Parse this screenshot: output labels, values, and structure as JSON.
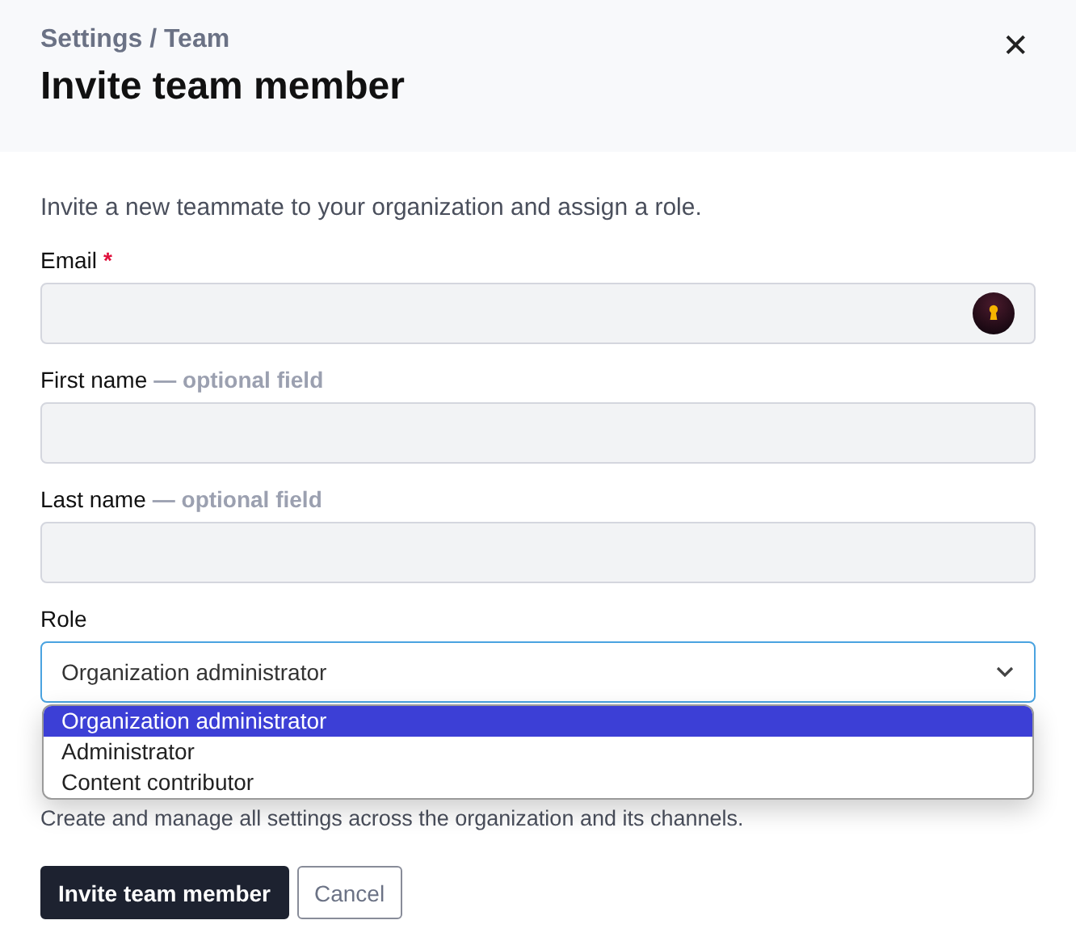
{
  "header": {
    "breadcrumb": "Settings / Team",
    "title": "Invite team member",
    "close": "✕"
  },
  "intro": "Invite a new teammate to your organization and assign a role.",
  "fields": [
    {
      "kind": "text",
      "label": "Email",
      "required_mark": "*",
      "autofill": true
    },
    {
      "kind": "text",
      "label": "First name",
      "hint": "— optional field"
    },
    {
      "kind": "text",
      "label": "Last name",
      "hint": "— optional field"
    },
    {
      "kind": "select",
      "label": "Role",
      "value": "Organization administrator",
      "expanded": true,
      "options": [
        {
          "label": "Organization administrator",
          "selected": true
        },
        {
          "label": "Administrator",
          "selected": false
        },
        {
          "label": "Content contributor",
          "selected": false
        }
      ],
      "help": "Create and manage all settings across the organization and its channels."
    }
  ],
  "buttons": [
    {
      "kind": "primary",
      "label": "Invite team member"
    },
    {
      "kind": "secondary",
      "label": "Cancel"
    }
  ]
}
